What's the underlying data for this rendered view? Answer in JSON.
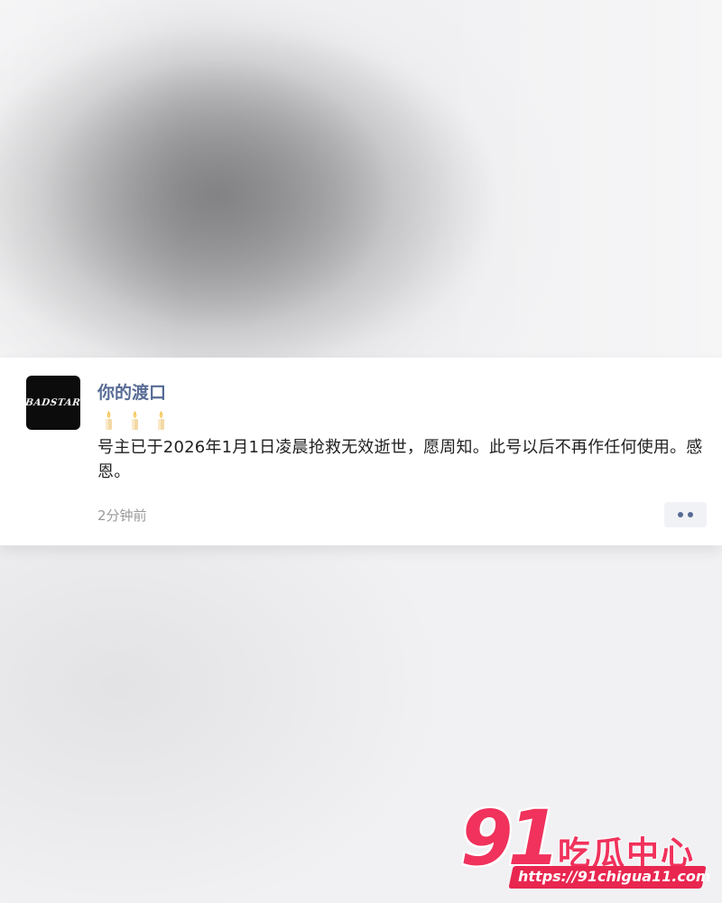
{
  "post": {
    "avatar_text": "BADSTAR",
    "author": "你的渡口",
    "candles": [
      "candle-icon",
      "candle-icon",
      "candle-icon"
    ],
    "content": "号主已于2026年1月1日凌晨抢救无效逝世，愿周知。此号以后不再作任何使用。感恩。",
    "time": "2分钟前"
  },
  "colors": {
    "author_link": "#576b95",
    "watermark": "#f0325c"
  },
  "watermark": {
    "number": "91",
    "name": "吃瓜中心",
    "url": "https://91chigua11.com"
  }
}
